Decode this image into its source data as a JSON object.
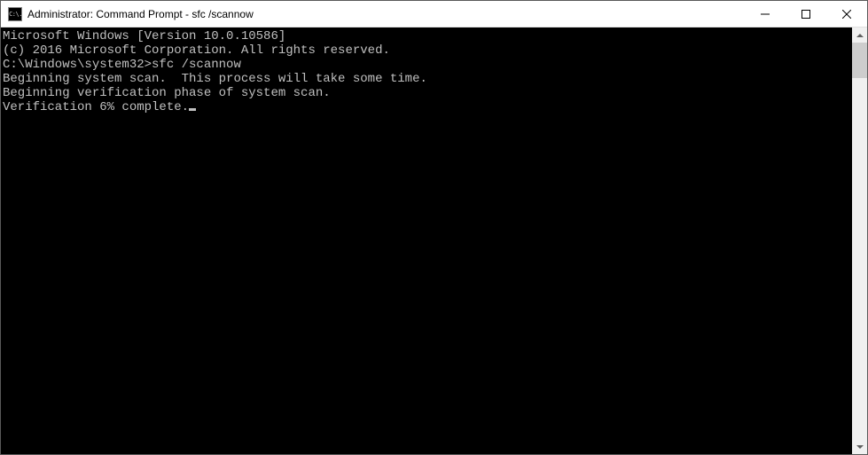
{
  "window": {
    "title": "Administrator: Command Prompt - sfc  /scannow",
    "icon_label": "C:\\."
  },
  "terminal": {
    "lines": [
      "Microsoft Windows [Version 10.0.10586]",
      "(c) 2016 Microsoft Corporation. All rights reserved.",
      "",
      "C:\\Windows\\system32>sfc /scannow",
      "",
      "Beginning system scan.  This process will take some time.",
      "",
      "Beginning verification phase of system scan.",
      "Verification 6% complete."
    ]
  }
}
